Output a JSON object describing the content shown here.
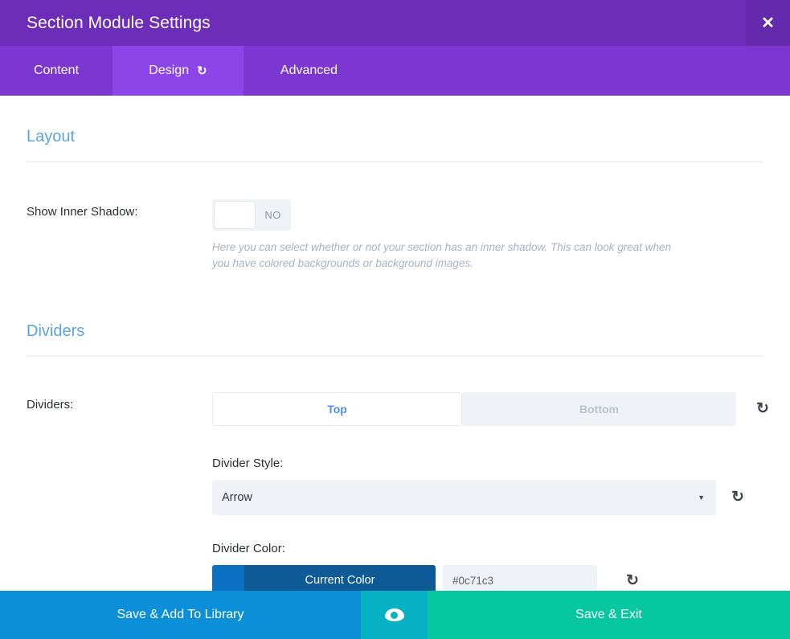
{
  "header": {
    "title": "Section Module Settings",
    "close_label": "✕"
  },
  "tabs": [
    {
      "label": "Content",
      "active": false
    },
    {
      "label": "Design",
      "active": true,
      "reset_glyph": "↺"
    },
    {
      "label": "Advanced",
      "active": false
    }
  ],
  "sections": {
    "layout": {
      "title": "Layout",
      "inner_shadow": {
        "label": "Show Inner Shadow:",
        "state": "NO",
        "help": "Here you can select whether or not your section has an inner shadow. This can look great when you have colored backgrounds or background images."
      }
    },
    "dividers": {
      "title": "Dividers",
      "label": "Dividers:",
      "segments": [
        {
          "label": "Top",
          "active": true
        },
        {
          "label": "Bottom",
          "active": false
        }
      ],
      "reset_glyph": "↺",
      "divider_style": {
        "label": "Divider Style:",
        "value": "Arrow",
        "caret": "▼",
        "reset_glyph": "↺"
      },
      "divider_color": {
        "label": "Divider Color:",
        "button_label": "Current Color",
        "swatch_hex": "#0c71c3",
        "hex_value": "#0c71c3",
        "reset_glyph": "↺"
      }
    }
  },
  "footer": {
    "save_library_label": "Save & Add To Library",
    "preview_icon": "eye-icon",
    "save_exit_label": "Save & Exit"
  }
}
